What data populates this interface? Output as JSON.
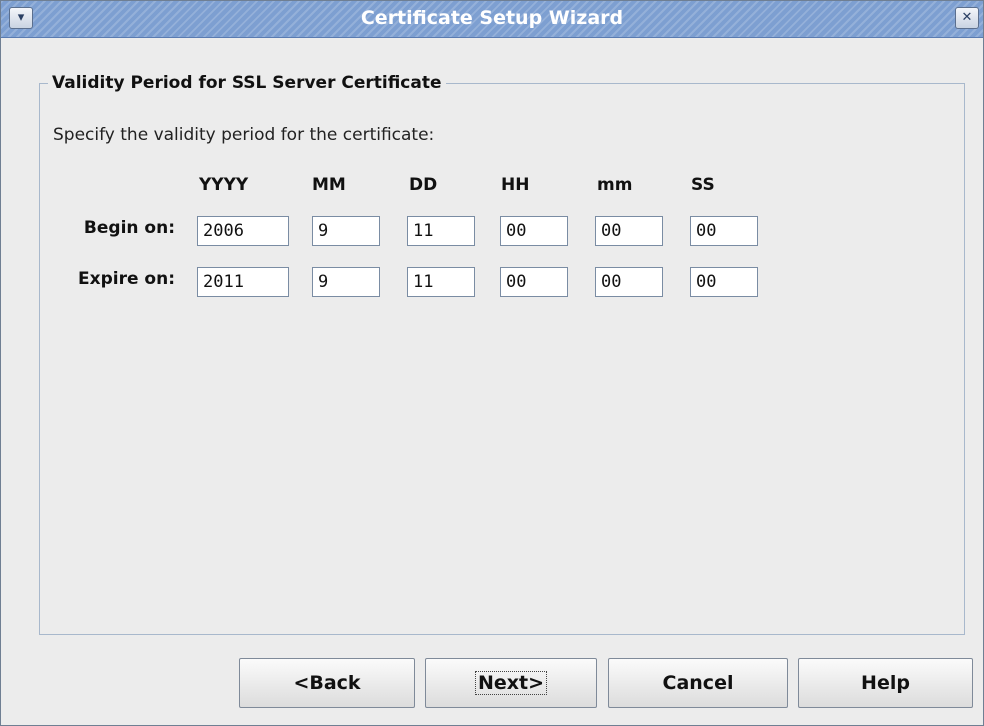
{
  "window": {
    "title": "Certificate Setup Wizard"
  },
  "group": {
    "title": "Validity Period for SSL Server Certificate",
    "intro": "Specify the validity period for the certificate:"
  },
  "columns": [
    "YYYY",
    "MM",
    "DD",
    "HH",
    "mm",
    "SS"
  ],
  "rows": [
    {
      "label": "Begin on:",
      "values": [
        "2006",
        "9",
        "11",
        "00",
        "00",
        "00"
      ]
    },
    {
      "label": "Expire on:",
      "values": [
        "2011",
        "9",
        "11",
        "00",
        "00",
        "00"
      ]
    }
  ],
  "buttons": {
    "back": "<Back",
    "next": "Next>",
    "cancel": "Cancel",
    "help": "Help"
  },
  "icons": {
    "menu": "chevron-down-icon",
    "close": "close-icon"
  }
}
